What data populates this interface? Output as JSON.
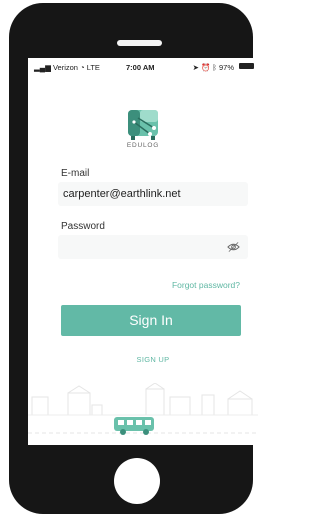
{
  "status_bar": {
    "carrier": "Verizon",
    "network": "LTE",
    "time": "7:00 AM",
    "battery": "97%"
  },
  "logo": {
    "text": "EDULOG"
  },
  "form": {
    "email_label": "E-mail",
    "email_value": "carpenter@earthlink.net",
    "password_label": "Password",
    "password_value": ""
  },
  "links": {
    "forgot_password": "Forgot password?",
    "sign_up": "SIGN UP"
  },
  "buttons": {
    "sign_in": "Sign In"
  },
  "colors": {
    "accent": "#62b9a6",
    "phone_body": "#161616"
  },
  "icons": [
    "signal-icon",
    "wifi-icon",
    "location-icon",
    "alarm-icon",
    "bluetooth-icon",
    "battery-icon",
    "eye-icon",
    "bus-icon"
  ]
}
